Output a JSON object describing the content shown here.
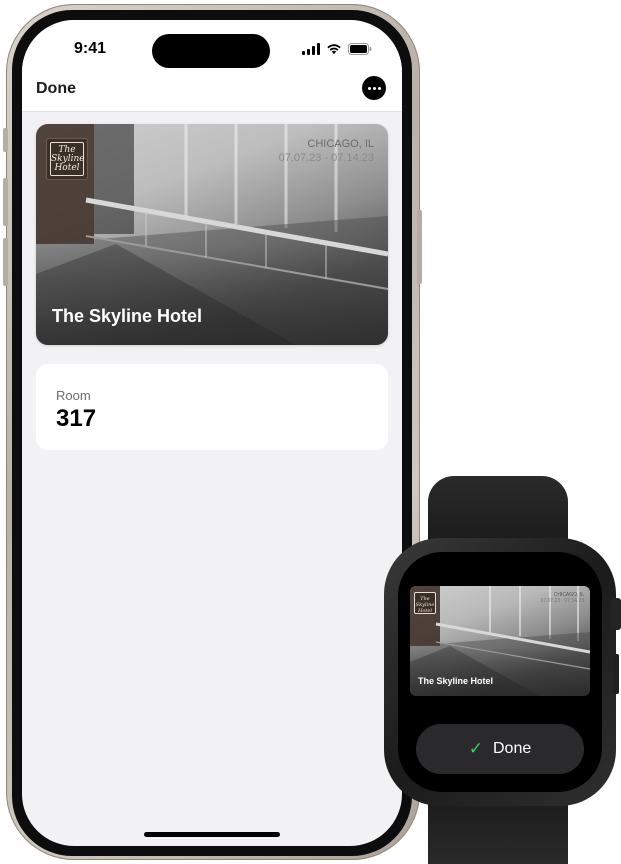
{
  "status_bar": {
    "time": "9:41"
  },
  "nav": {
    "done_label": "Done",
    "more_icon": "ellipsis-circle-icon"
  },
  "pass": {
    "logo_text": "The Skyline Hotel",
    "city": "CHICAGO, IL",
    "dates": "07.07.23 - 07.14.23",
    "hotel_name": "The Skyline Hotel"
  },
  "room": {
    "label": "Room",
    "value": "317"
  },
  "watch": {
    "logo_text": "The Skyline Hotel",
    "city": "CHICAGO, IL",
    "dates": "07.07.23 - 07.14.23",
    "hotel_name": "The Skyline Hotel",
    "done_label": "Done",
    "check_icon": "checkmark-icon"
  },
  "colors": {
    "accent_check": "#3bd16f",
    "screen_bg": "#f2f2f5",
    "card_bg": "#ffffff"
  }
}
